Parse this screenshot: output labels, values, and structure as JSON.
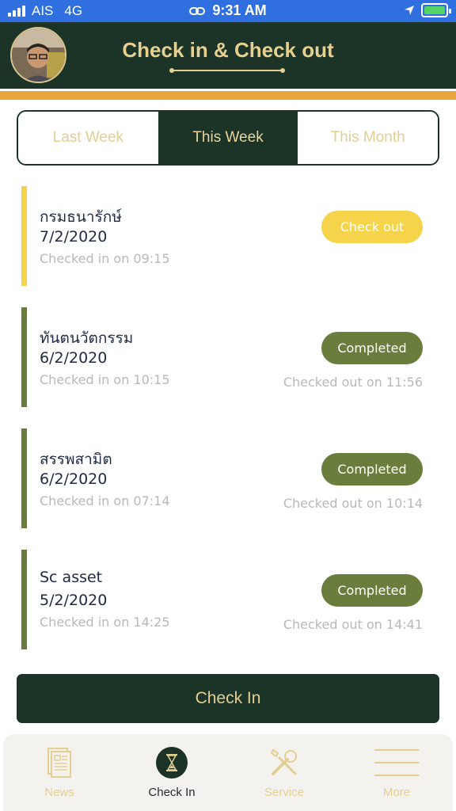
{
  "status_bar": {
    "carrier": "AIS",
    "network": "4G",
    "time": "9:31 AM",
    "battery_color": "#56d364"
  },
  "header": {
    "title": "Check in & Check out",
    "background_color": "#1c3328",
    "accent_color": "#e9a63c",
    "title_color": "#e5d08f"
  },
  "tabs": [
    {
      "label": "Last Week",
      "active": false
    },
    {
      "label": "This Week",
      "active": true
    },
    {
      "label": "This Month",
      "active": false
    }
  ],
  "records": [
    {
      "place": "กรมธนารักษ์",
      "date": "7/2/2020",
      "checked_in": "Checked in on 09:15",
      "status": "Check out",
      "checked_out": "",
      "bar_color": "#f5d34a",
      "badge_color": "#f5d34a"
    },
    {
      "place": "ทันตนวัตกรรม",
      "date": "6/2/2020",
      "checked_in": "Checked in on 10:15",
      "status": "Completed",
      "checked_out": "Checked out on 11:56",
      "bar_color": "#6b7d3c",
      "badge_color": "#6b7d3c"
    },
    {
      "place": "สรรพสามิต",
      "date": "6/2/2020",
      "checked_in": "Checked in on 07:14",
      "status": "Completed",
      "checked_out": "Checked out on 10:14",
      "bar_color": "#6b7d3c",
      "badge_color": "#6b7d3c"
    },
    {
      "place": "Sc asset",
      "date": "5/2/2020",
      "checked_in": "Checked in on 14:25",
      "status": "Completed",
      "checked_out": "Checked out on 14:41",
      "bar_color": "#6b7d3c",
      "badge_color": "#6b7d3c"
    }
  ],
  "primary_button": {
    "label": "Check In"
  },
  "bottom_nav": [
    {
      "label": "News",
      "icon": "news-icon",
      "active": false
    },
    {
      "label": "Check In",
      "icon": "hourglass-icon",
      "active": true
    },
    {
      "label": "Service",
      "icon": "tools-icon",
      "active": false
    },
    {
      "label": "More",
      "icon": "menu-icon",
      "active": false
    }
  ]
}
